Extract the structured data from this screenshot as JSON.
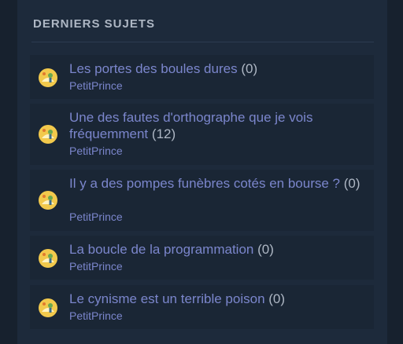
{
  "section": {
    "title": "DERNIERS SUJETS"
  },
  "topics": [
    {
      "title": "Les portes des boules dures",
      "count": "(0)",
      "author": "PetitPrince",
      "avatar_icon": "little-prince-avatar-icon"
    },
    {
      "title": "Une des fautes d'orthographe que je vois fréquemment",
      "count": "(12)",
      "author": "PetitPrince",
      "avatar_icon": "little-prince-avatar-icon"
    },
    {
      "title": "Il y a des pompes funèbres cotés en bourse ?",
      "count": "(0)",
      "author": "PetitPrince",
      "avatar_icon": "little-prince-avatar-icon"
    },
    {
      "title": "La boucle de la programmation",
      "count": "(0)",
      "author": "PetitPrince",
      "avatar_icon": "little-prince-avatar-icon"
    },
    {
      "title": "Le cynisme est un terrible poison",
      "count": "(0)",
      "author": "PetitPrince",
      "avatar_icon": "little-prince-avatar-icon"
    }
  ],
  "colors": {
    "background": "#17212e",
    "panel": "#1d2a3b",
    "topic_row": "#1a2635",
    "link": "#7b86cc",
    "muted_text": "#aeb7c4"
  }
}
